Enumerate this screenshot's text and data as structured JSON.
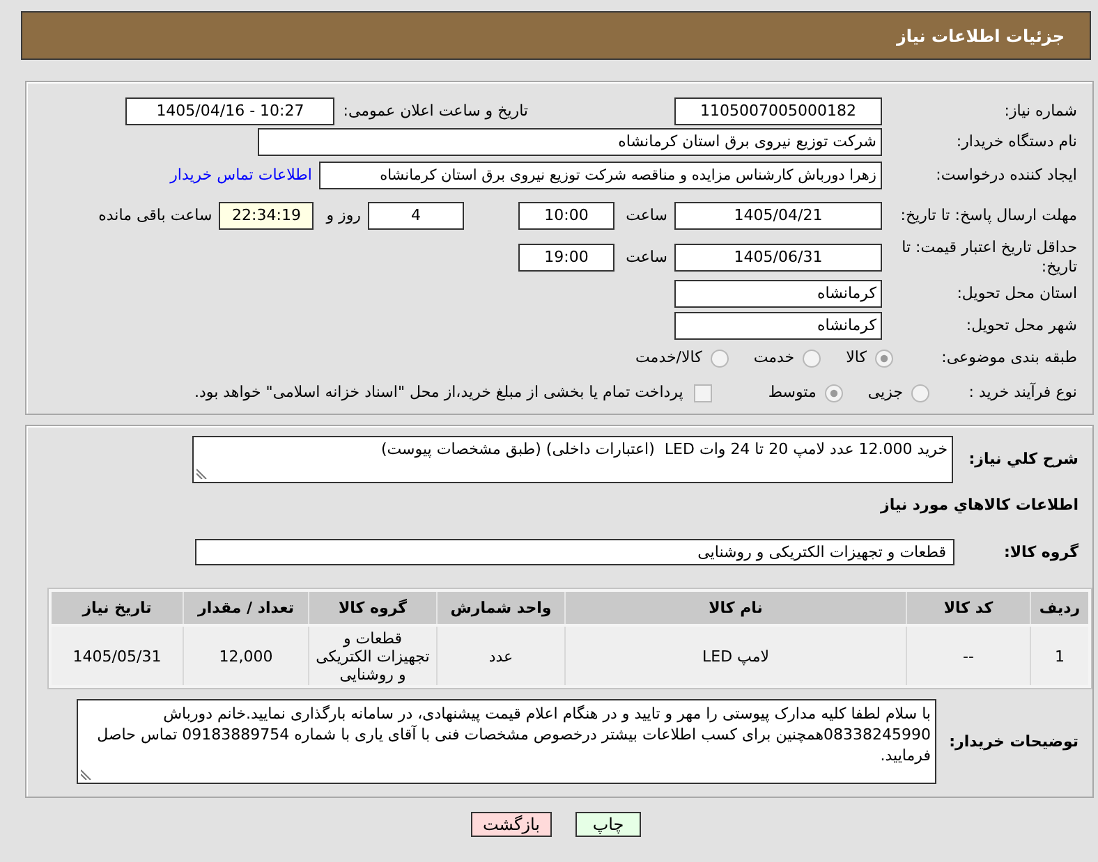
{
  "header": {
    "title": "جزئیات اطلاعات نیاز"
  },
  "details": {
    "need_number": {
      "label": "شماره نیاز:",
      "value": "1105007005000182"
    },
    "announce_datetime": {
      "label": "تاریخ و ساعت اعلان عمومی:",
      "value": "1405/04/16 - 10:27"
    },
    "buyer_org": {
      "label": "نام دستگاه خریدار:",
      "value": "شرکت توزیع نیروی برق استان کرمانشاه"
    },
    "requester": {
      "label": "ایجاد کننده درخواست:",
      "value": "زهرا دورباش کارشناس مزایده و مناقصه شرکت توزیع نیروی برق استان کرمانشاه",
      "contact_link": "اطلاعات تماس خریدار"
    },
    "response_deadline": {
      "label": "مهلت ارسال پاسخ: تا تاریخ:",
      "date": "1405/04/21",
      "time_label": "ساعت",
      "time": "10:00",
      "days": "4",
      "days_label": "روز و",
      "remaining": "22:34:19",
      "remaining_label": "ساعت باقی مانده"
    },
    "price_validity": {
      "label": "حداقل تاریخ اعتبار قیمت: تا تاریخ:",
      "date": "1405/06/31",
      "time_label": "ساعت",
      "time": "19:00"
    },
    "delivery_province": {
      "label": "استان محل تحویل:",
      "value": "کرمانشاه"
    },
    "delivery_city": {
      "label": "شهر محل تحویل:",
      "value": "کرمانشاه"
    },
    "category": {
      "label": "طبقه بندی موضوعی:",
      "options": [
        {
          "label": "کالا",
          "selected": true
        },
        {
          "label": "خدمت",
          "selected": false
        },
        {
          "label": "کالا/خدمت",
          "selected": false
        }
      ]
    },
    "purchase_process": {
      "label": "نوع فرآیند خرید :",
      "options": [
        {
          "label": "جزیی",
          "selected": false
        },
        {
          "label": "متوسط",
          "selected": true
        }
      ],
      "treasury_payment": {
        "label": "پرداخت تمام یا بخشی از مبلغ خرید،از محل \"اسناد خزانه اسلامی\" خواهد بود.",
        "checked": false
      }
    }
  },
  "need": {
    "description_label": "شرح کلي نیاز:",
    "description": "خرید 12.000 عدد لامپ 20 تا 24 وات LED  (اعتبارات داخلی) (طبق مشخصات پیوست)",
    "goods_title": "اطلاعات کالاهاي مورد نیاز",
    "group_label": "گروه کالا:",
    "group": "قطعات و تجهیزات الکتریکی و روشنایی"
  },
  "table": {
    "columns": [
      "ردیف",
      "کد کالا",
      "نام کالا",
      "واحد شمارش",
      "گروه کالا",
      "تعداد / مقدار",
      "تاریخ نیاز"
    ],
    "rows": [
      [
        "1",
        "--",
        "لامپ LED",
        "عدد",
        "قطعات و تجهیزات الکتریکی و روشنایی",
        "12,000",
        "1405/05/31"
      ]
    ]
  },
  "buyer_notes": {
    "label": "توضیحات خریدار:",
    "value": "با سلام لطفا کلیه مدارک پیوستی را مهر و تایید و در هنگام اعلام قیمت پیشنهادی، در سامانه بارگذاری نمایید.خانم دورباش 08338245990همچنین برای کسب اطلاعات بیشتر درخصوص مشخصات فنی با آقای یاری با شماره 09183889754 تماس حاصل فرمایید."
  },
  "buttons": [
    {
      "label": "چاپ",
      "kind": "print"
    },
    {
      "label": "بازگشت",
      "kind": "back"
    }
  ]
}
